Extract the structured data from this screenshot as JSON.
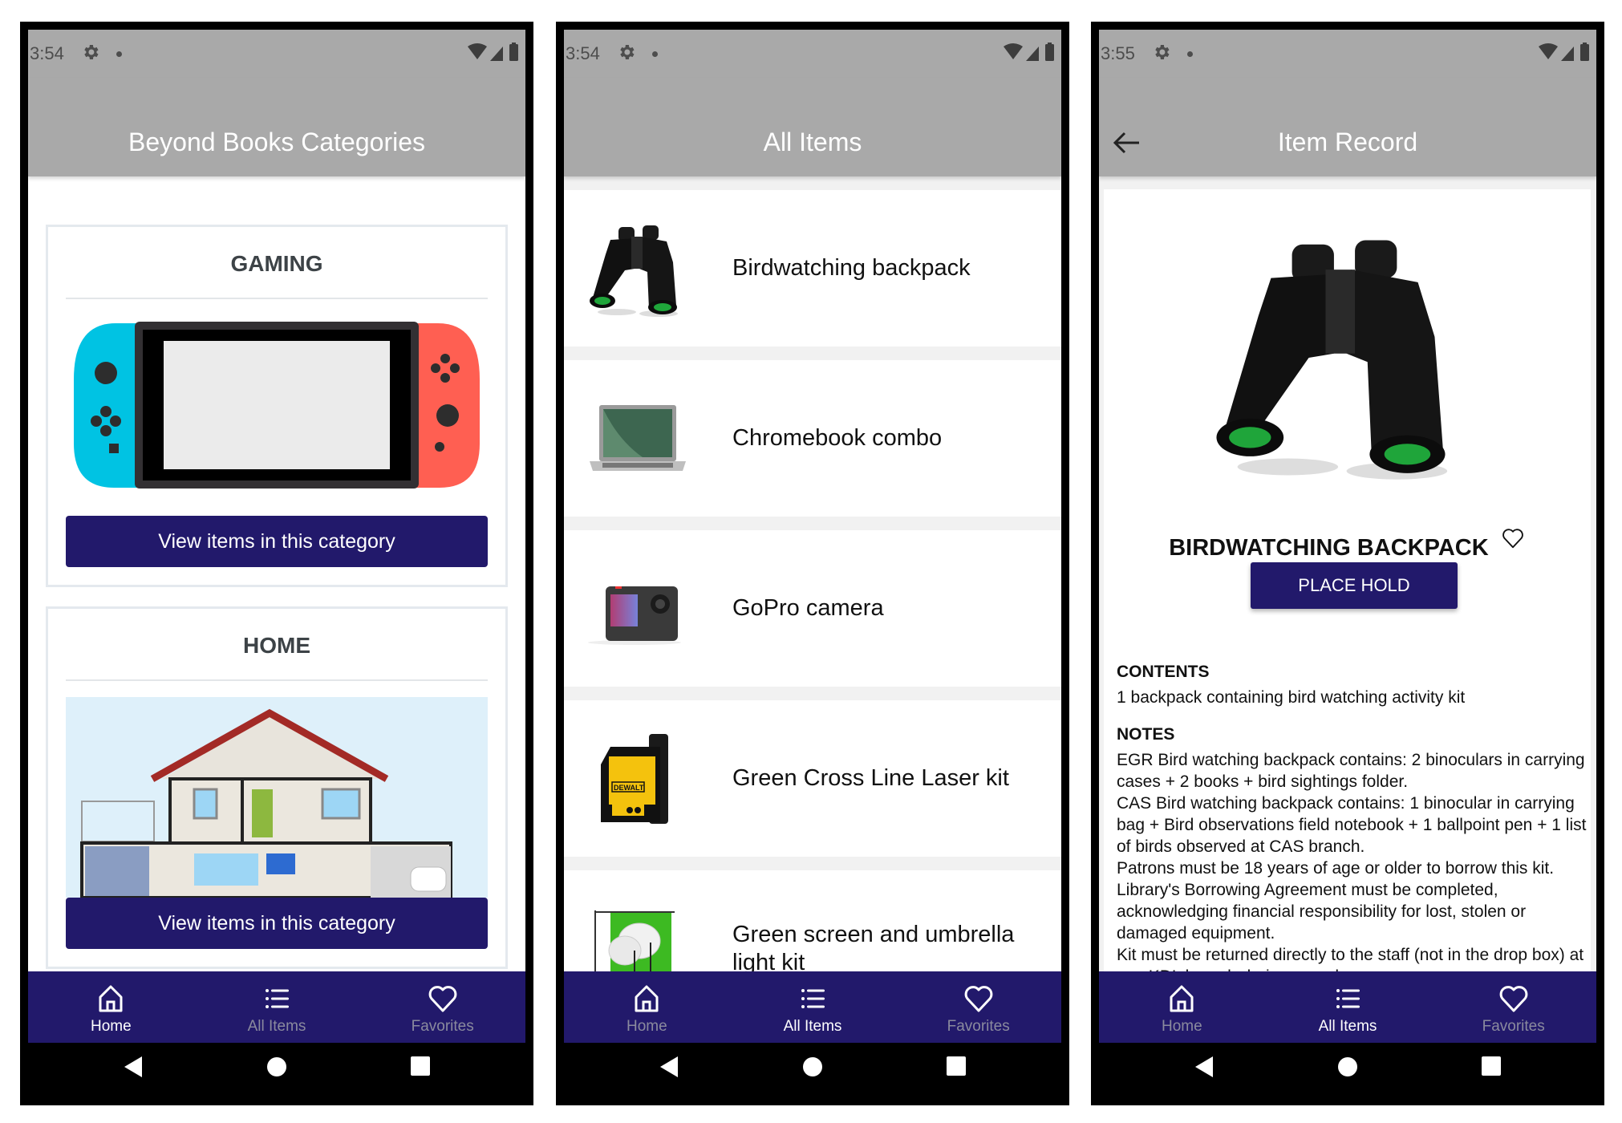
{
  "screens": [
    {
      "status": {
        "time": "3:54"
      },
      "title": "Beyond Books Categories",
      "categories": [
        {
          "name": "GAMING",
          "image": "nintendo-switch-illustration",
          "button_label": "View items in this category"
        },
        {
          "name": "HOME",
          "image": "house-cross-section-illustration",
          "button_label": "View items in this category"
        }
      ],
      "nav": [
        {
          "label": "Home",
          "icon": "home-icon",
          "active": true
        },
        {
          "label": "All Items",
          "icon": "list-icon",
          "active": false
        },
        {
          "label": "Favorites",
          "icon": "heart-icon",
          "active": false
        }
      ]
    },
    {
      "status": {
        "time": "3:54"
      },
      "title": "All Items",
      "items": [
        {
          "name": "Birdwatching backpack",
          "image": "binoculars"
        },
        {
          "name": "Chromebook combo",
          "image": "laptop"
        },
        {
          "name": "GoPro camera",
          "image": "action-camera"
        },
        {
          "name": "Green Cross Line Laser kit",
          "image": "dewalt-laser",
          "brand": "DEWALT"
        },
        {
          "name": "Green screen and umbrella light kit",
          "image": "green-screen"
        }
      ],
      "nav": [
        {
          "label": "Home",
          "icon": "home-icon",
          "active": false
        },
        {
          "label": "All Items",
          "icon": "list-icon",
          "active": true
        },
        {
          "label": "Favorites",
          "icon": "heart-icon",
          "active": false
        }
      ]
    },
    {
      "status": {
        "time": "3:55"
      },
      "title": "Item Record",
      "record": {
        "name": "BIRDWATCHING BACKPACK",
        "hold_label": "PLACE HOLD",
        "contents_heading": "CONTENTS",
        "contents": "1 backpack containing bird watching activity kit",
        "notes_heading": "NOTES",
        "notes": [
          "EGR Bird watching backpack contains: 2 binoculars in carrying cases + 2 books + bird sightings folder.",
          "CAS Bird watching backpack contains: 1 binocular in carrying bag + Bird observations field notebook + 1 ballpoint pen + 1 list of birds observed at CAS branch.",
          "Patrons must be 18 years of age or older to borrow this kit. Library's Borrowing Agreement must be completed, acknowledging financial responsibility for lost, stolen or damaged equipment.",
          "Kit must be returned directly to the staff (not in the drop box) at any KDL branch during open hour."
        ]
      },
      "nav": [
        {
          "label": "Home",
          "icon": "home-icon",
          "active": false
        },
        {
          "label": "All Items",
          "icon": "list-icon",
          "active": true
        },
        {
          "label": "Favorites",
          "icon": "heart-icon",
          "active": false
        }
      ]
    }
  ],
  "colors": {
    "primary": "#22196b",
    "appbar": "#a9a9a9",
    "nav_inactive": "#8a8a9e"
  }
}
